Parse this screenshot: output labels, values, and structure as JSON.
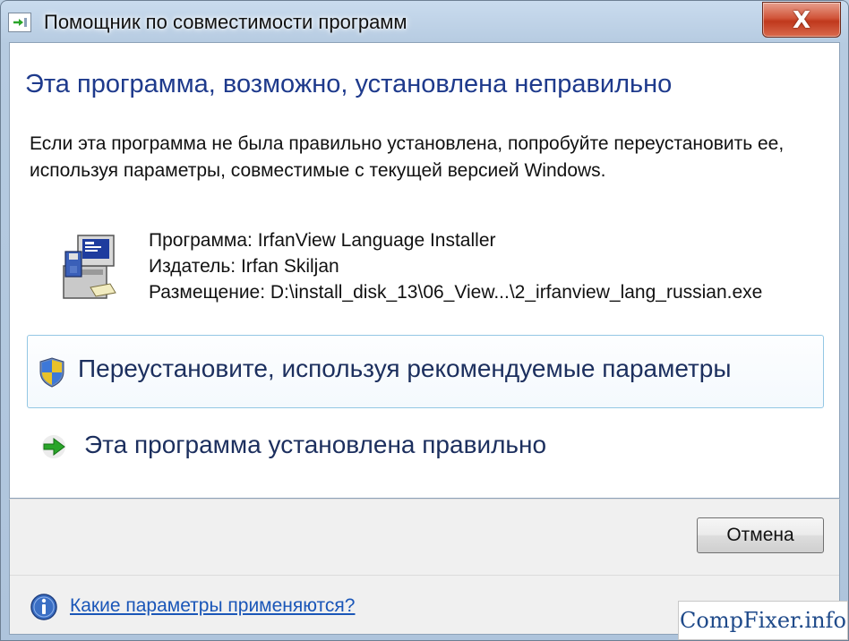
{
  "window": {
    "title": "Помощник по совместимости программ",
    "close_label": "X"
  },
  "main": {
    "heading": "Эта программа, возможно, установлена неправильно",
    "description": "Если эта программа не была правильно установлена, попробуйте переустановить ее, используя параметры, совместимые с текущей версией Windows.",
    "program_line": "Программа: IrfanView Language Installer",
    "publisher_line": "Издатель: Irfan Skiljan",
    "location_line": "Размещение: D:\\install_disk_13\\06_View...\\2_irfanview_lang_russian.exe"
  },
  "options": {
    "reinstall_label": "Переустановите, используя рекомендуемые параметры",
    "installed_ok_label": "Эта программа установлена правильно"
  },
  "footer": {
    "cancel_label": "Отмена",
    "help_link": "Какие параметры применяются?"
  },
  "watermark": {
    "text": "CompFixer.info"
  },
  "icons": {
    "title": "compatibility-assistant-icon",
    "program": "installer-program-icon",
    "shield": "uac-shield-icon",
    "arrow": "green-arrow-icon",
    "info": "info-icon"
  },
  "colors": {
    "heading": "#1e3a8c",
    "link": "#1a56b8",
    "close": "#c0381c",
    "arrow": "#2aa52a"
  }
}
